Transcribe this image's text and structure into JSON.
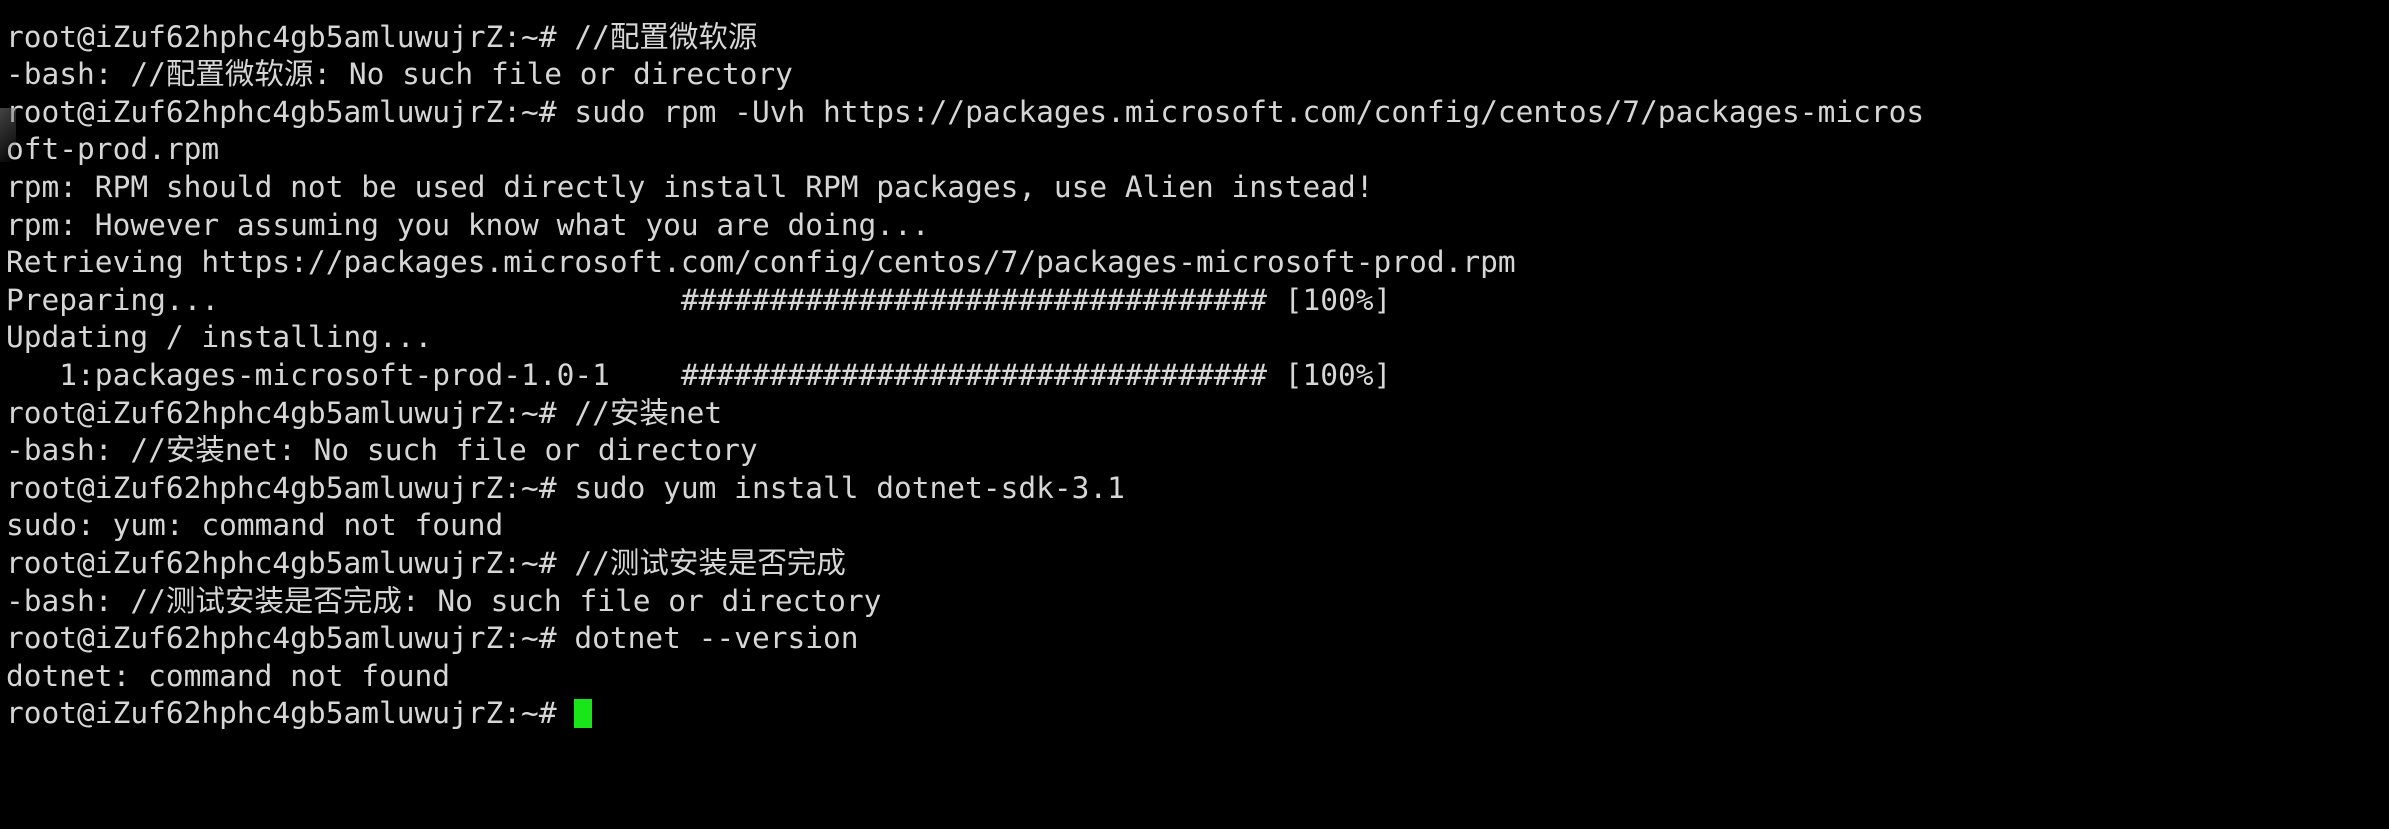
{
  "terminal": {
    "title": "root@iZuf62hphc4gb5amluwujrZ: ~",
    "prompt": "root@iZuf62hphc4gb5amluwujrZ:~#",
    "hostname": "iZuf62hphc4gb5amluwujrZ",
    "user": "root",
    "cwd": "~",
    "background_color": "#000000",
    "foreground_color": "#d6d6d6",
    "cursor_color": "#19e619",
    "cursor_glyph": "block",
    "font": "monospace",
    "columns": 139,
    "rows": 22,
    "lines": [
      {
        "id": "line-00-clipped",
        "text": "",
        "kind": "clipped-top"
      },
      {
        "id": "line-01-prompt",
        "text": "root@iZuf62hphc4gb5amluwujrZ:~# //配置微软源",
        "kind": "command"
      },
      {
        "id": "line-02-error",
        "text": "-bash: //配置微软源: No such file or directory",
        "kind": "output"
      },
      {
        "id": "line-03-prompt",
        "text": "root@iZuf62hphc4gb5amluwujrZ:~# sudo rpm -Uvh https://packages.microsoft.com/config/centos/7/packages-micros",
        "kind": "command"
      },
      {
        "id": "line-04-wrap",
        "text": "oft-prod.rpm",
        "kind": "command-wrap"
      },
      {
        "id": "line-05-output",
        "text": "rpm: RPM should not be used directly install RPM packages, use Alien instead!",
        "kind": "output"
      },
      {
        "id": "line-06-output",
        "text": "rpm: However assuming you know what you are doing...",
        "kind": "output"
      },
      {
        "id": "line-07-output",
        "text": "Retrieving https://packages.microsoft.com/config/centos/7/packages-microsoft-prod.rpm",
        "kind": "output"
      },
      {
        "id": "line-08-progress",
        "text": "Preparing...                          ################################# [100%]",
        "kind": "progress"
      },
      {
        "id": "line-09-output",
        "text": "Updating / installing...",
        "kind": "output"
      },
      {
        "id": "line-10-progress",
        "text": "   1:packages-microsoft-prod-1.0-1    ################################# [100%]",
        "kind": "progress"
      },
      {
        "id": "line-11-prompt",
        "text": "root@iZuf62hphc4gb5amluwujrZ:~# //安装net",
        "kind": "command"
      },
      {
        "id": "line-12-error",
        "text": "-bash: //安装net: No such file or directory",
        "kind": "output"
      },
      {
        "id": "line-13-prompt",
        "text": "root@iZuf62hphc4gb5amluwujrZ:~# sudo yum install dotnet-sdk-3.1",
        "kind": "command"
      },
      {
        "id": "line-14-error",
        "text": "sudo: yum: command not found",
        "kind": "output"
      },
      {
        "id": "line-15-prompt",
        "text": "root@iZuf62hphc4gb5amluwujrZ:~# //测试安装是否完成",
        "kind": "command"
      },
      {
        "id": "line-16-error",
        "text": "-bash: //测试安装是否完成: No such file or directory",
        "kind": "output"
      },
      {
        "id": "line-17-prompt",
        "text": "root@iZuf62hphc4gb5amluwujrZ:~# dotnet --version",
        "kind": "command"
      },
      {
        "id": "line-18-error",
        "text": "dotnet: command not found",
        "kind": "output"
      }
    ],
    "final_prompt": "root@iZuf62hphc4gb5amluwujrZ:~# ",
    "progress_values": [
      "[100%]",
      "[100%]"
    ],
    "commands_entered": [
      "//配置微软源",
      "sudo rpm -Uvh https://packages.microsoft.com/config/centos/7/packages-microsoft-prod.rpm",
      "//安装net",
      "sudo yum install dotnet-sdk-3.1",
      "//测试安装是否完成",
      "dotnet --version"
    ]
  }
}
